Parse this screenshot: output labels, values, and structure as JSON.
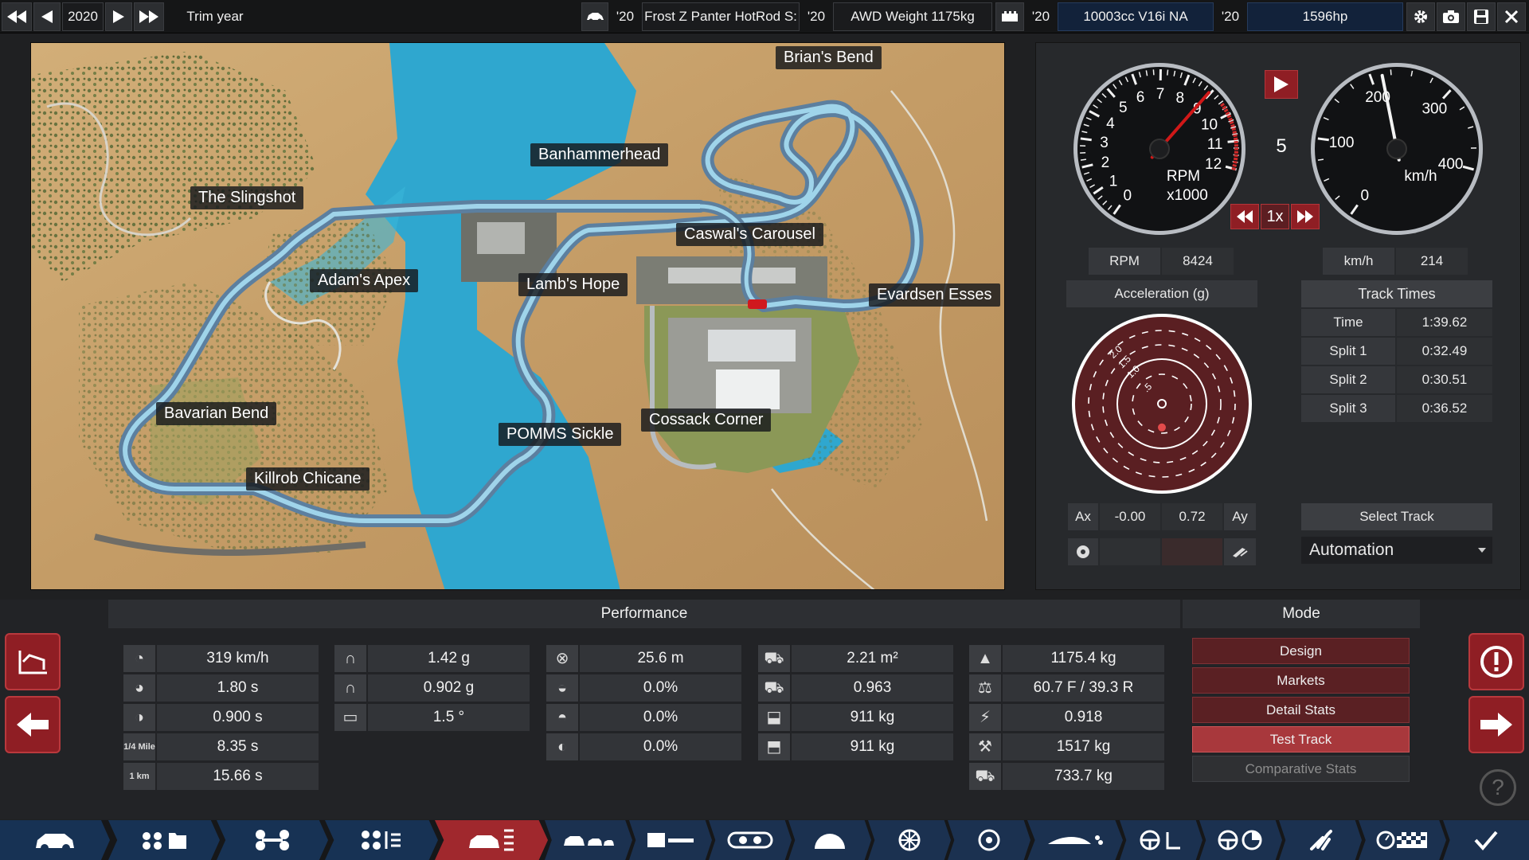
{
  "topbar": {
    "year": "2020",
    "trim_year_label": "Trim year",
    "model_year": "'20",
    "car_name": "Frost Z Panter HotRod S:",
    "body_year": "'20",
    "weight_info": "AWD Weight 1175kg",
    "engine_year": "'20",
    "engine": "10003cc V16i NA",
    "power_year": "'20",
    "power": "1596hp"
  },
  "track": {
    "corners": [
      "Brian's Bend",
      "Banhammerhead",
      "The Slingshot",
      "Caswal's Carousel",
      "Adam's Apex",
      "Lamb's Hope",
      "Evardsen Esses",
      "Bavarian Bend",
      "POMMS Sickle",
      "Cossack Corner",
      "Killrob Chicane"
    ]
  },
  "gauges": {
    "rpm_ticks": [
      "0",
      "1",
      "2",
      "3",
      "4",
      "5",
      "6",
      "7",
      "8",
      "9",
      "10",
      "11",
      "12"
    ],
    "rpm_unit": "RPM",
    "rpm_scale": "x1000",
    "rpm_fraction": 0.745,
    "gear": "5",
    "speed_ticks": [
      "0",
      "100",
      "200",
      "300",
      "400"
    ],
    "speed_unit": "km/h",
    "speed_fraction": 0.535,
    "playback_speed": "1x",
    "rpm_label": "RPM",
    "rpm_value": "8424",
    "kmh_label": "km/h",
    "kmh_value": "214",
    "accel_title": "Acceleration (g)",
    "accel_rings": [
      "2.0",
      "1.5",
      "1.0",
      ".5"
    ],
    "ax_label": "Ax",
    "ax_value": "-0.00",
    "ay_value": "0.72",
    "ay_label": "Ay"
  },
  "track_times": {
    "title": "Track Times",
    "rows": [
      {
        "label": "Time",
        "value": "1:39.62"
      },
      {
        "label": "Split 1",
        "value": "0:32.49"
      },
      {
        "label": "Split 2",
        "value": "0:30.51"
      },
      {
        "label": "Split 3",
        "value": "0:36.52"
      }
    ],
    "select_track": "Select Track",
    "track_name": "Automation"
  },
  "performance": {
    "title": "Performance",
    "col1": [
      {
        "icon": "top-speed",
        "value": "319 km/h"
      },
      {
        "icon": "0-100",
        "value": "1.80 s"
      },
      {
        "icon": "80-120",
        "value": "0.900 s"
      },
      {
        "icon": "quarter-mile",
        "label": "1/4 Mile",
        "value": "8.35 s"
      },
      {
        "icon": "one-km",
        "label": "1 km",
        "value": "15.66 s"
      }
    ],
    "col2": [
      {
        "icon": "cornering",
        "value": "1.42 g"
      },
      {
        "icon": "cornering-low",
        "value": "0.902 g"
      },
      {
        "icon": "body-roll",
        "value": "1.5 °"
      }
    ],
    "col3": [
      {
        "icon": "braking",
        "value": "25.6 m"
      },
      {
        "icon": "brake-fade-1",
        "value": "0.0%"
      },
      {
        "icon": "brake-fade-2",
        "value": "0.0%"
      },
      {
        "icon": "brake-fade-3",
        "value": "0.0%"
      }
    ],
    "col4": [
      {
        "icon": "frontal-area",
        "value": "2.21 m²"
      },
      {
        "icon": "drag",
        "value": "0.963"
      },
      {
        "icon": "downforce-front",
        "value": "911 kg"
      },
      {
        "icon": "downforce-rear",
        "value": "911 kg"
      }
    ],
    "col5": [
      {
        "icon": "weight",
        "value": "1175.4 kg"
      },
      {
        "icon": "distribution",
        "value": "60.7 F / 39.3 R"
      },
      {
        "icon": "power-weight",
        "value": "0.918"
      },
      {
        "icon": "max-weight",
        "value": "1517 kg"
      },
      {
        "icon": "towing",
        "value": "733.7 kg"
      }
    ]
  },
  "mode": {
    "title": "Mode",
    "buttons": [
      "Design",
      "Markets",
      "Detail Stats",
      "Test Track",
      "Comparative Stats"
    ]
  },
  "colors": {
    "accent_red": "#a0282d",
    "nav_blue": "#1b3150",
    "water": "#3fb3d6",
    "sand": "#caa46f"
  }
}
